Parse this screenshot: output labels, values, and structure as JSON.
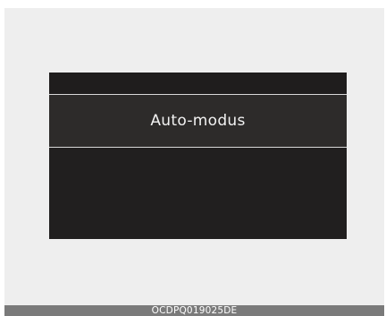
{
  "display": {
    "selected_mode": "Auto-modus"
  },
  "caption": {
    "code": "OCDPQ019025DE"
  },
  "colors": {
    "frame_background": "#eeeeee",
    "display_background": "#211f1f",
    "highlight_row": "#2d2b2a",
    "divider": "#d8d8d8",
    "text": "#f2f2f2",
    "caption_bar": "#7a7a7a"
  }
}
